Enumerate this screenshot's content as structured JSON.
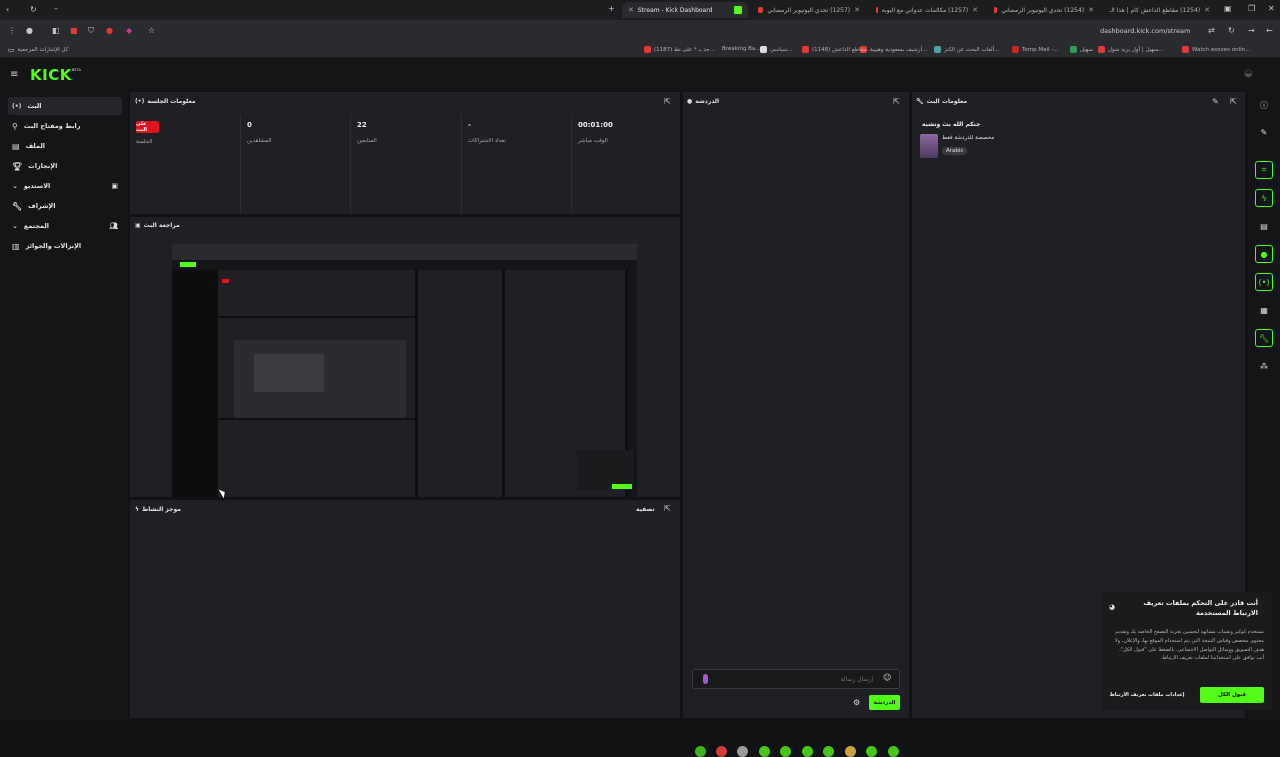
{
  "browser": {
    "tabs": [
      {
        "title": "(1254) مقاطع الداعش كام | هذا الـ"
      },
      {
        "title": "(1254) تحدي اليوتيوبر الرمضاني"
      },
      {
        "title": "(1257) مكالمات عدواني مع البوبة"
      },
      {
        "title": "(1257) تحدي اليوتيوبر الرمضاني"
      },
      {
        "title": "Stream - Kick Dashboard"
      }
    ],
    "url": "dashboard.kick.com/stream",
    "bookmarks": [
      {
        "label": "Watch esoves onlin..."
      },
      {
        "label": "سهيل | أول بريد شول..."
      },
      {
        "label": "سهيل"
      },
      {
        "label": "Temp Mail -..."
      },
      {
        "label": "ألعاب البحث عن الكنز..."
      },
      {
        "label": "أرشيف بسعودية وهيبية..."
      },
      {
        "label": "(1148) مقاطع الداعش..."
      },
      {
        "label": "سياسي..."
      },
      {
        "label": "Breaking Ba..."
      },
      {
        "label": "(1187) جد بـ * على تط..."
      },
      {
        "label": "كل الإشارات المرجعية"
      }
    ]
  },
  "app": {
    "logo": "KICK",
    "logo_badge": "BETA",
    "sidebar": [
      {
        "label": "البث"
      },
      {
        "label": "رابط ومفتاح البث"
      },
      {
        "label": "الملف"
      },
      {
        "label": "الإنجازات"
      },
      {
        "label": "الاستديو"
      },
      {
        "label": "الإشراف"
      },
      {
        "label": "المجتمع"
      },
      {
        "label": "الإنزالات والجوائز"
      }
    ],
    "session": {
      "title": "معلومات الجلسة",
      "live_badge": "على البث",
      "session_label": "الجلسة",
      "stats": [
        {
          "value": "0",
          "label": "المشاهدين"
        },
        {
          "value": "22",
          "label": "المتابعين"
        },
        {
          "value": "-",
          "label": "تعداد الاشتراكات"
        },
        {
          "value": "00:01:00",
          "label": "الوقت مباشر"
        }
      ]
    },
    "stream_review": {
      "title": "مراجعة البث"
    },
    "activity": {
      "title": "موجز النشاط",
      "filter_label": "تصفية"
    },
    "chat": {
      "title": "الدردشة",
      "input_placeholder": "إرسال رسالة",
      "send_label": "الدردشة"
    },
    "stream_info": {
      "title": "معلومات البث",
      "stream_title": "جنكم الله بث ونشبه",
      "category": "مخصصة للدردشة فقط",
      "language": "Arabic"
    },
    "cookie": {
      "title": "أنت قادر على التحكم بملفات تعريف الارتباط المستخدمة",
      "body": "نستخدم كوكيز وتقنيات مشابهة لتحسين تجربة التصفح الخاصة بك وتقديم محتوى مخصص وقياس النتيجة التي يتم استخدام الموقع بها، والإعلان، ولا هدف التسويق ووسائل التواصل الاجتماعي. بالضغط على \"قبول الكل\"، أنت توافق على استخدامنا لملفات تعريف الارتباط.",
      "settings_label": "إعدادات ملفات تعريف الارتباط",
      "accept_label": "قبول الكل"
    },
    "colors": {
      "accent": "#53fc18",
      "live": "#e0141e",
      "panel": "#1f2023",
      "bg": "#141517"
    }
  }
}
